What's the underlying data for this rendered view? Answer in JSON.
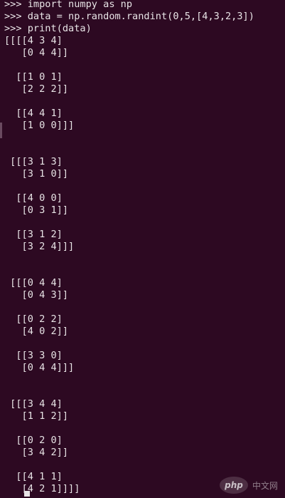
{
  "terminal": {
    "background": "#2d0922",
    "foreground": "#e8e4e6",
    "lines": [
      ">>> import numpy as np",
      ">>> data = np.random.randint(0,5,[4,3,2,3])",
      ">>> print(data)",
      "[[[[4 3 4]",
      "   [0 4 4]]",
      "",
      "  [[1 0 1]",
      "   [2 2 2]]",
      "",
      "  [[4 4 1]",
      "   [1 0 0]]]",
      "",
      "",
      " [[[3 1 3]",
      "   [3 1 0]]",
      "",
      "  [[4 0 0]",
      "   [0 3 1]]",
      "",
      "  [[3 1 2]",
      "   [3 2 4]]]",
      "",
      "",
      " [[[0 4 4]",
      "   [0 4 3]]",
      "",
      "  [[0 2 2]",
      "   [4 0 2]]",
      "",
      "  [[3 3 0]",
      "   [0 4 4]]]",
      "",
      "",
      " [[[3 4 4]",
      "   [1 1 2]]",
      "",
      "  [[0 2 0]",
      "   [3 4 2]]",
      "",
      "  [[4 1 1]",
      "   [4 2 1]]]]"
    ]
  },
  "watermark": {
    "logo": "php",
    "text": "中文网"
  }
}
